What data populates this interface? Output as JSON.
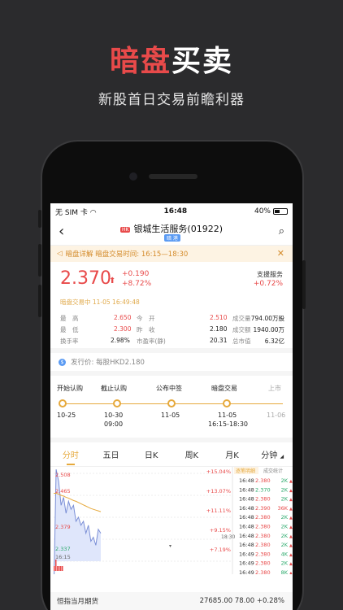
{
  "hero": {
    "title_red": "暗盘",
    "title_white": "买卖",
    "subtitle": "新股首日交易前瞻利器"
  },
  "status_bar": {
    "carrier": "无 SIM 卡",
    "time": "16:48",
    "battery": "40%"
  },
  "nav": {
    "hk_badge": "HK",
    "title": "银城生活服务(01922)",
    "sub_badge": "暗 港"
  },
  "notice": {
    "text": "暗盘详解  暗盘交易时间: 16:15—18:30"
  },
  "quote": {
    "price": "2.370",
    "change": "+0.190",
    "change_pct": "+8.72%",
    "support_label": "支援服务",
    "support_value": "+0.72%",
    "status": "暗盘交易中  11-05 16:49:48"
  },
  "stats": {
    "high_label": "最　高",
    "high": "2.650",
    "low_label": "最　低",
    "low": "2.300",
    "turnover_label": "换手率",
    "turnover": "2.98%",
    "open_label": "今　开",
    "open": "2.510",
    "prev_label": "昨　收",
    "prev": "2.180",
    "pe_label": "市盈率(静)",
    "pe": "20.31",
    "vol_label": "成交量",
    "vol": "794.00万股",
    "amt_label": "成交额",
    "amt": "1940.00万",
    "mcap_label": "总市值",
    "mcap": "6.32亿"
  },
  "ipo": {
    "coin": "$",
    "label": "发行价:  每股HKD2.180"
  },
  "timeline": [
    {
      "label": "开始认购",
      "date": "10-25",
      "date2": ""
    },
    {
      "label": "截止认购",
      "date": "10-30",
      "date2": "09:00"
    },
    {
      "label": "公布中签",
      "date": "11-05",
      "date2": ""
    },
    {
      "label": "暗盘交易",
      "date": "11-05",
      "date2": "16:15-18:30"
    },
    {
      "label": "上市",
      "date": "11-06",
      "date2": ""
    }
  ],
  "tabs": [
    "分时",
    "五日",
    "日K",
    "周K",
    "月K",
    "分钟"
  ],
  "chart_data": {
    "type": "line",
    "y_ticks": [
      "2.508",
      "2.465",
      "2.379",
      "2.337"
    ],
    "pct_ticks": [
      "+15.04%",
      "+13.07%",
      "+11.11%",
      "+9.15%",
      "+7.19%"
    ],
    "time_label": "16:15",
    "x": [
      0,
      1,
      2,
      3,
      4,
      5,
      6,
      7,
      8,
      9,
      10,
      11,
      12,
      13,
      14,
      15,
      16,
      17,
      18,
      19
    ],
    "values": [
      2.2,
      2.53,
      2.5,
      2.44,
      2.46,
      2.42,
      2.45,
      2.43,
      2.44,
      2.4,
      2.41,
      2.39,
      2.4,
      2.37,
      2.39,
      2.35,
      2.36,
      2.34,
      2.38,
      2.37
    ],
    "avg_values": [
      2.47,
      2.47,
      2.468,
      2.465,
      2.463,
      2.46,
      2.458,
      2.455,
      2.452,
      2.45,
      2.447,
      2.444,
      2.441,
      2.438,
      2.435,
      2.432,
      2.43,
      2.428,
      2.426,
      2.424
    ],
    "ylim": [
      2.3,
      2.52
    ]
  },
  "ticks_table": {
    "header_left": "逐笔明细",
    "header_right": "成交统计",
    "rows": [
      {
        "time": "16:48",
        "price": "2.380",
        "vol": "2K"
      },
      {
        "time": "16:48",
        "price": "2.370",
        "vol": "2K"
      },
      {
        "time": "16:48",
        "price": "2.380",
        "vol": "2K"
      },
      {
        "time": "16:48",
        "price": "2.390",
        "vol": "36K"
      },
      {
        "time": "16:48",
        "price": "2.380",
        "vol": "2K"
      },
      {
        "time": "16:48",
        "price": "2.380",
        "vol": "2K"
      },
      {
        "time": "16:48",
        "price": "2.380",
        "vol": "2K"
      },
      {
        "time": "16:48",
        "price": "2.380",
        "vol": "2K"
      },
      {
        "time": "16:49",
        "price": "2.380",
        "vol": "4K"
      },
      {
        "time": "16:49",
        "price": "2.380",
        "vol": "2K"
      },
      {
        "time": "16:49",
        "price": "2.380",
        "vol": "8K"
      }
    ],
    "side_time": "18:30"
  },
  "futures": {
    "label": "恒指当月期货",
    "value": "27685.00  78.00  +0.28%"
  },
  "colors": {
    "red": "#e84a4a",
    "green": "#2aa96b",
    "accent": "#e6a93c"
  }
}
